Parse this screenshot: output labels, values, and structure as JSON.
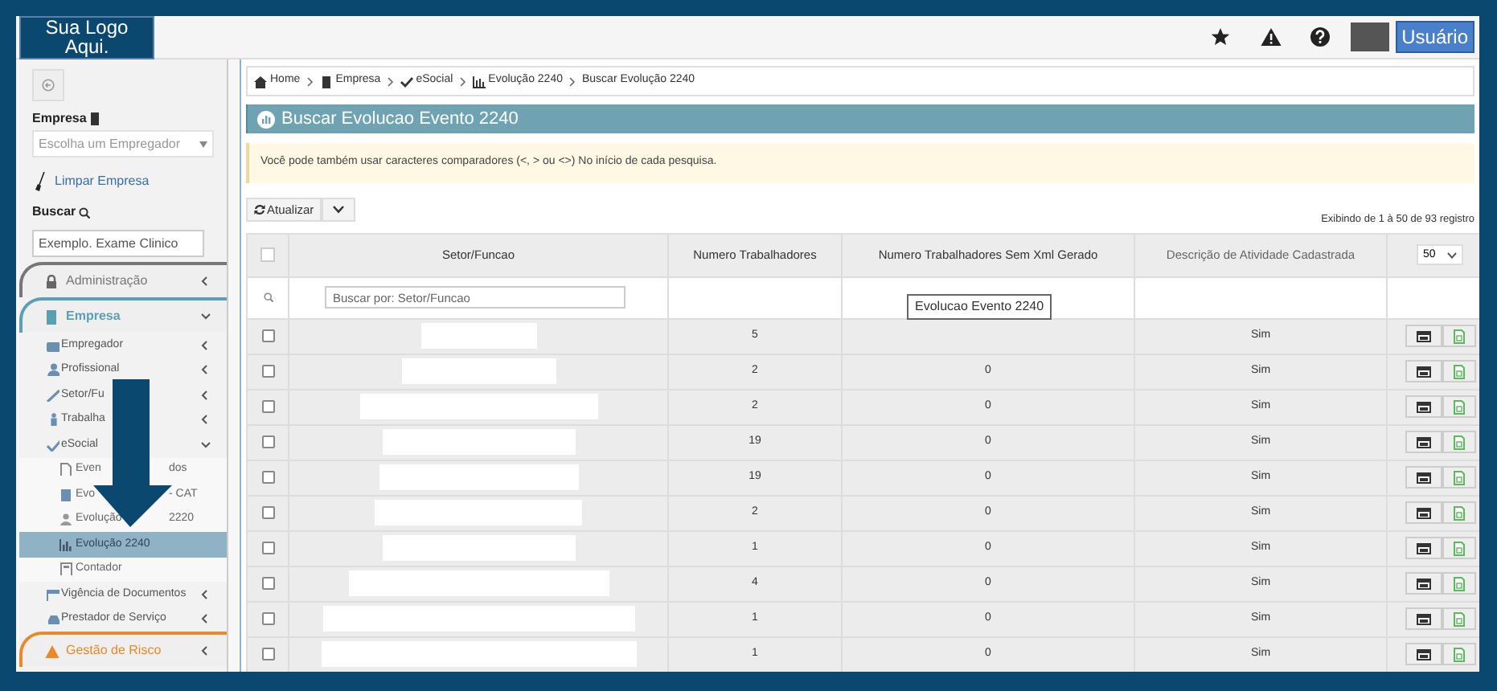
{
  "header": {
    "logo_text": "Sua Logo Aqui.",
    "user_button": "Usuário"
  },
  "sidebar": {
    "empresa_label": "Empresa",
    "empresa_select": {
      "placeholder": "Escolha um Empregador"
    },
    "clear_link": "Limpar Empresa",
    "search_label": "Buscar",
    "search_field": {
      "placeholder": "Exemplo. Exame Clinico"
    },
    "menu": [
      {
        "kind": "section",
        "label": "Administração",
        "expanded": false,
        "color": "#777777"
      },
      {
        "kind": "section",
        "label": "Empresa",
        "expanded": true,
        "color": "#5a9fb4"
      },
      {
        "kind": "item",
        "label": "Empregador",
        "expanded": false
      },
      {
        "kind": "item",
        "label": "Profissional",
        "expanded": false
      },
      {
        "kind": "item",
        "label": "Setor/Fu",
        "expanded": false
      },
      {
        "kind": "item",
        "label": "Trabalha",
        "expanded": false
      },
      {
        "kind": "item",
        "label": "eSocial",
        "expanded": true
      },
      {
        "kind": "subitem",
        "label": "Even",
        "suffix": "dos",
        "selected": false
      },
      {
        "kind": "subitem",
        "label": "Evo",
        "suffix": "- CAT",
        "selected": false
      },
      {
        "kind": "subitem",
        "label": "Evolução",
        "suffix": "2220",
        "selected": false
      },
      {
        "kind": "subitem",
        "label": "Evolução 2240",
        "selected": true
      },
      {
        "kind": "subitem",
        "label": "Contador",
        "selected": false
      },
      {
        "kind": "item",
        "label": "Vigência de Documentos",
        "expanded": false
      },
      {
        "kind": "item",
        "label": "Prestador de Serviço",
        "expanded": false
      },
      {
        "kind": "section",
        "label": "Gestão de Risco",
        "expanded": false,
        "color": "#e8892c"
      }
    ]
  },
  "breadcrumb": [
    {
      "label": "Home"
    },
    {
      "label": "Empresa"
    },
    {
      "label": "eSocial"
    },
    {
      "label": "Evolução 2240"
    },
    {
      "label": "Buscar Evolução 2240"
    }
  ],
  "title": "Buscar Evolucao Evento 2240",
  "alert": "Você pode também usar caracteres comparadores (<, > ou <>) No início de cada pesquisa.",
  "toolbar": {
    "refresh_button": "Atualizar",
    "records_info": "Exibindo de 1 à 50 de 93 registro",
    "page_size": "50"
  },
  "table": {
    "columns": [
      "Setor/Funcao",
      "Numero Trabalhadores",
      "Numero Trabalhadores Sem Xml Gerado",
      "Descrição de Atividade Cadastrada"
    ],
    "all_selected": false,
    "filter": {
      "placeholder": "Buscar por: Setor/Funcao"
    },
    "rows": [
      {
        "checked": false,
        "workers": "5",
        "description": "Sim"
      },
      {
        "checked": false,
        "workers": "2",
        "without_xml": "0",
        "description": "Sim"
      },
      {
        "checked": false,
        "workers": "2",
        "without_xml": "0",
        "description": "Sim"
      },
      {
        "checked": false,
        "workers": "19",
        "without_xml": "0",
        "description": "Sim"
      },
      {
        "checked": false,
        "workers": "19",
        "without_xml": "0",
        "description": "Sim"
      },
      {
        "checked": false,
        "workers": "2",
        "without_xml": "0",
        "description": "Sim"
      },
      {
        "checked": false,
        "workers": "1",
        "without_xml": "0",
        "description": "Sim"
      },
      {
        "checked": false,
        "workers": "4",
        "without_xml": "0",
        "description": "Sim"
      },
      {
        "checked": false,
        "workers": "1",
        "without_xml": "0",
        "description": "Sim"
      },
      {
        "checked": false,
        "workers": "1",
        "without_xml": "0",
        "description": "Sim"
      }
    ]
  },
  "tooltip": "Evolucao Evento 2240"
}
